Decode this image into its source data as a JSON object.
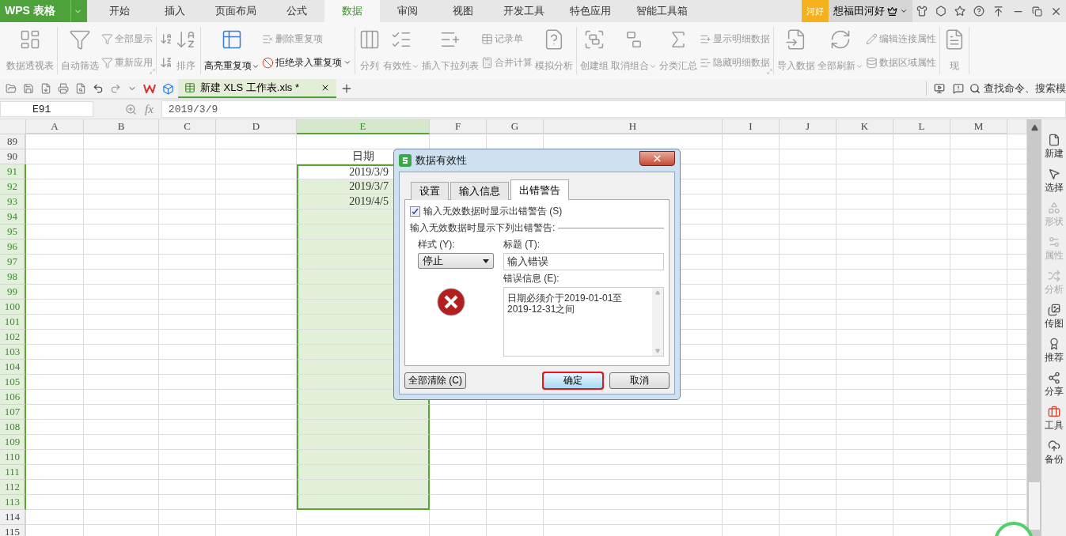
{
  "app_button": {
    "label": "WPS 表格"
  },
  "menu_tabs": [
    {
      "label": "开始",
      "selected": false
    },
    {
      "label": "插入",
      "selected": false
    },
    {
      "label": "页面布局",
      "selected": false
    },
    {
      "label": "公式",
      "selected": false
    },
    {
      "label": "数据",
      "selected": true
    },
    {
      "label": "审阅",
      "selected": false
    },
    {
      "label": "视图",
      "selected": false
    },
    {
      "label": "开发工具",
      "selected": false
    },
    {
      "label": "特色应用",
      "selected": false
    },
    {
      "label": "智能工具箱",
      "selected": false
    }
  ],
  "account": {
    "badge": "河好",
    "name": "想福田河好"
  },
  "ribbon": {
    "groups": [
      {
        "items": [
          {
            "kind": "large",
            "label": "数据透视表",
            "disabled": true
          }
        ]
      },
      {
        "launcher": true,
        "items": [
          {
            "kind": "large",
            "label": "自动筛选",
            "disabled": true
          },
          {
            "kind": "stack",
            "children": [
              {
                "label": "全部显示",
                "disabled": true
              },
              {
                "label": "重新应用",
                "disabled": true
              }
            ]
          }
        ]
      },
      {
        "items": [
          {
            "kind": "sort_icons"
          },
          {
            "kind": "large",
            "label": "排序",
            "disabled": true
          }
        ]
      },
      {
        "items": [
          {
            "kind": "large",
            "label": "高亮重复项",
            "disabled": false,
            "dropdown": true
          },
          {
            "kind": "stack",
            "children": [
              {
                "label": "删除重复项",
                "disabled": true
              },
              {
                "label": "拒绝录入重复项",
                "disabled": false,
                "dropdown": true
              }
            ]
          }
        ]
      },
      {
        "items": [
          {
            "kind": "large",
            "label": "分列",
            "disabled": true
          },
          {
            "kind": "large",
            "label": "有效性",
            "disabled": true,
            "dropdown": true
          },
          {
            "kind": "large",
            "label": "插入下拉列表",
            "disabled": true
          },
          {
            "kind": "stack",
            "children": [
              {
                "label": "记录单",
                "disabled": true
              },
              {
                "label": "合并计算",
                "disabled": true
              }
            ]
          },
          {
            "kind": "large",
            "label": "模拟分析",
            "disabled": true
          }
        ]
      },
      {
        "launcher": true,
        "items": [
          {
            "kind": "large",
            "label": "创建组",
            "disabled": true
          },
          {
            "kind": "large",
            "label": "取消组合",
            "disabled": true,
            "dropdown": true
          },
          {
            "kind": "large",
            "label": "分类汇总",
            "disabled": true
          },
          {
            "kind": "stack",
            "children": [
              {
                "label": "显示明细数据",
                "disabled": true
              },
              {
                "label": "隐藏明细数据",
                "disabled": true
              }
            ]
          }
        ]
      },
      {
        "items": [
          {
            "kind": "large",
            "label": "导入数据",
            "disabled": true
          },
          {
            "kind": "large",
            "label": "全部刷新",
            "disabled": true,
            "dropdown": true
          },
          {
            "kind": "stack",
            "children": [
              {
                "label": "编辑连接属性",
                "disabled": true
              },
              {
                "label": "数据区域属性",
                "disabled": true
              }
            ]
          }
        ]
      },
      {
        "items": [
          {
            "kind": "large",
            "label": "现",
            "disabled": true
          }
        ]
      }
    ]
  },
  "document_tab": {
    "label": "新建 XLS 工作表.xls *",
    "selected": true
  },
  "search": {
    "placeholder": "查找命令、搜索模"
  },
  "formula_bar": {
    "cell": "E91",
    "fx": "fx",
    "value": "2019/3/9"
  },
  "grid": {
    "columns": [
      {
        "label": "A",
        "selected": false
      },
      {
        "label": "B",
        "selected": false
      },
      {
        "label": "C",
        "selected": false
      },
      {
        "label": "D",
        "selected": false
      },
      {
        "label": "E",
        "selected": true
      },
      {
        "label": "F",
        "selected": false
      },
      {
        "label": "G",
        "selected": false
      },
      {
        "label": "H",
        "selected": false
      },
      {
        "label": "I",
        "selected": false
      },
      {
        "label": "J",
        "selected": false
      },
      {
        "label": "K",
        "selected": false
      },
      {
        "label": "L",
        "selected": false
      },
      {
        "label": "M",
        "selected": false
      }
    ],
    "rows": [
      {
        "label": "89",
        "selected": false
      },
      {
        "label": "90",
        "selected": false,
        "column_e": "日期"
      },
      {
        "label": "91",
        "selected": true,
        "active": true,
        "column_e": "2019/3/9"
      },
      {
        "label": "92",
        "selected": true,
        "active": false,
        "column_e": "2019/3/7"
      },
      {
        "label": "93",
        "selected": true,
        "active": false,
        "column_e": "2019/4/5"
      },
      {
        "label": "94",
        "selected": true,
        "active": false
      },
      {
        "label": "95",
        "selected": true,
        "active": false
      },
      {
        "label": "96",
        "selected": true,
        "active": false
      },
      {
        "label": "97",
        "selected": true,
        "active": false
      },
      {
        "label": "98",
        "selected": true,
        "active": false
      },
      {
        "label": "99",
        "selected": true,
        "active": false
      },
      {
        "label": "100",
        "selected": true,
        "active": false
      },
      {
        "label": "101",
        "selected": true,
        "active": false
      },
      {
        "label": "102",
        "selected": true,
        "active": false
      },
      {
        "label": "103",
        "selected": true,
        "active": false
      },
      {
        "label": "104",
        "selected": true,
        "active": false
      },
      {
        "label": "105",
        "selected": true,
        "active": false
      },
      {
        "label": "106",
        "selected": true,
        "active": false
      },
      {
        "label": "107",
        "selected": true,
        "active": false
      },
      {
        "label": "108",
        "selected": true,
        "active": false
      },
      {
        "label": "109",
        "selected": true,
        "active": false
      },
      {
        "label": "110",
        "selected": true,
        "active": false
      },
      {
        "label": "111",
        "selected": true,
        "active": false
      },
      {
        "label": "112",
        "selected": true,
        "active": false
      },
      {
        "label": "113",
        "selected": true,
        "active": false
      },
      {
        "label": "114",
        "selected": false
      },
      {
        "label": "115",
        "selected": false
      }
    ]
  },
  "side_panel": {
    "items": [
      {
        "label": "新建",
        "disabled": false
      },
      {
        "label": "选择",
        "disabled": false
      },
      {
        "label": "形状",
        "disabled": true
      },
      {
        "label": "属性",
        "disabled": true
      },
      {
        "label": "分析",
        "disabled": true
      },
      {
        "label": "传图",
        "disabled": false
      },
      {
        "label": "推荐",
        "disabled": false
      },
      {
        "label": "分享",
        "disabled": false
      },
      {
        "label": "工具",
        "disabled": false
      },
      {
        "label": "备份",
        "disabled": false
      }
    ]
  },
  "dialog": {
    "title": "数据有效性",
    "tabs": [
      {
        "label": "设置",
        "selected": false
      },
      {
        "label": "输入信息",
        "selected": false
      },
      {
        "label": "出错警告",
        "selected": true
      }
    ],
    "show_alert": {
      "label": "输入无效数据时显示出错警告 (S)",
      "checked": true
    },
    "section_label": "输入无效数据时显示下列出错警告:",
    "style_label": "样式 (Y):",
    "style_value": "停止",
    "title_label": "标题 (T):",
    "title_value": "输入错误",
    "message_label": "错误信息 (E):",
    "message": "日期必须介于2019-01-01至\n2019-12-31之间",
    "buttons": [
      {
        "label": "全部清除 (C)",
        "kind": "plain",
        "highlighted": false
      },
      {
        "label": "确定",
        "kind": "default",
        "highlighted": true
      },
      {
        "label": "取消",
        "kind": "plain",
        "highlighted": false
      }
    ]
  }
}
